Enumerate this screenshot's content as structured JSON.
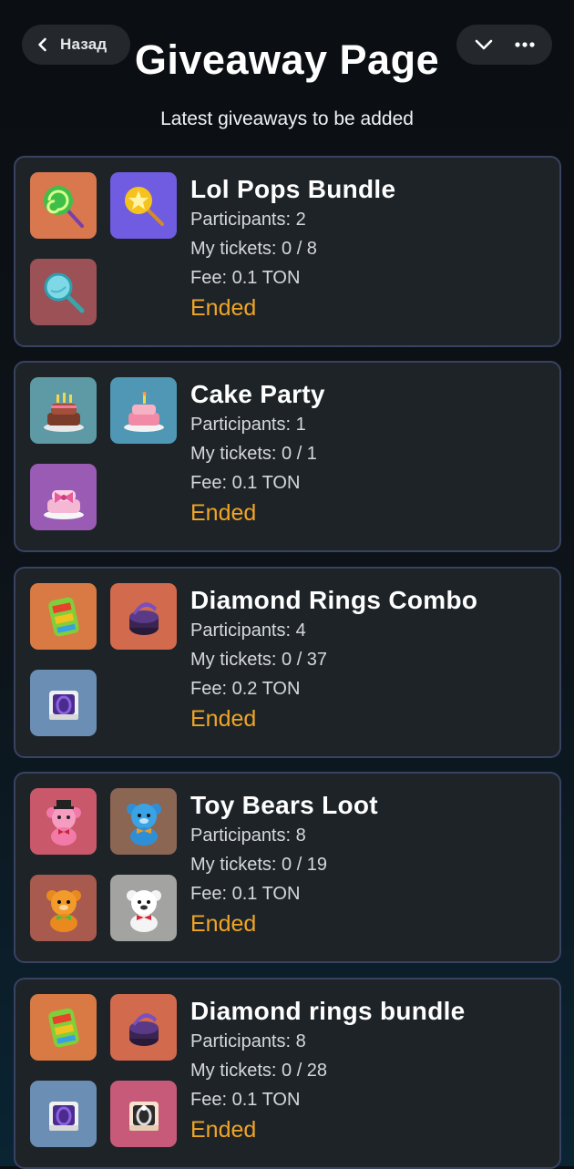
{
  "header": {
    "back_label": "Назад",
    "title": "Giveaway Page",
    "subtitle": "Latest giveaways to be added"
  },
  "colors": {
    "accent_status": "#f0a526",
    "card_border": "#3a4262",
    "card_bg": "#1d2327"
  },
  "labels": {
    "participants": "Participants:",
    "tickets": "My tickets:",
    "fee": "Fee:"
  },
  "giveaways": [
    {
      "name": "Lol Pops Bundle",
      "participants": "Participants: 2",
      "tickets": "My tickets: 0 / 8",
      "fee": "Fee: 0.1 TON",
      "status": "Ended",
      "items": [
        {
          "icon": "green-lollipop-icon",
          "bg": "#d9784e"
        },
        {
          "icon": "yellow-lollipop-icon",
          "bg": "#6f5ce0"
        },
        {
          "icon": "magnifier-lollipop-icon",
          "bg": "#9b5156"
        }
      ]
    },
    {
      "name": "Cake Party",
      "participants": "Participants: 1",
      "tickets": "My tickets: 0 / 1",
      "fee": "Fee: 0.1 TON",
      "status": "Ended",
      "items": [
        {
          "icon": "chocolate-cake-icon",
          "bg": "#5e9aa6"
        },
        {
          "icon": "pink-cake-icon",
          "bg": "#4f97b4"
        },
        {
          "icon": "bow-cake-icon",
          "bg": "#9a5bb5"
        }
      ]
    },
    {
      "name": "Diamond Rings Combo",
      "participants": "Participants: 4",
      "tickets": "My tickets: 0 / 37",
      "fee": "Fee: 0.2 TON",
      "status": "Ended",
      "items": [
        {
          "icon": "rainbow-ring-box-icon",
          "bg": "#d97a45"
        },
        {
          "icon": "purple-ring-box-icon",
          "bg": "#d26a4d"
        },
        {
          "icon": "open-ring-box-icon",
          "bg": "#6a8eb4"
        }
      ]
    },
    {
      "name": "Toy Bears Loot",
      "participants": "Participants: 8",
      "tickets": "My tickets: 0 / 19",
      "fee": "Fee: 0.1 TON",
      "status": "Ended",
      "items": [
        {
          "icon": "pink-bear-icon",
          "bg": "#c9586a"
        },
        {
          "icon": "blue-bear-icon",
          "bg": "#8b6652"
        },
        {
          "icon": "orange-bear-icon",
          "bg": "#a95a4e"
        },
        {
          "icon": "white-bear-icon",
          "bg": "#a3a3a1"
        }
      ]
    },
    {
      "name": "Diamond rings bundle",
      "participants": "Participants: 8",
      "tickets": "My tickets: 0 / 28",
      "fee": "Fee: 0.1 TON",
      "status": "Ended",
      "items": [
        {
          "icon": "rainbow-ring-box-icon",
          "bg": "#d97a45"
        },
        {
          "icon": "purple-ring-box-icon",
          "bg": "#d26a4d"
        },
        {
          "icon": "open-ring-box-icon",
          "bg": "#6a8eb4"
        },
        {
          "icon": "pink-ring-box-icon",
          "bg": "#c75a78"
        }
      ]
    }
  ]
}
